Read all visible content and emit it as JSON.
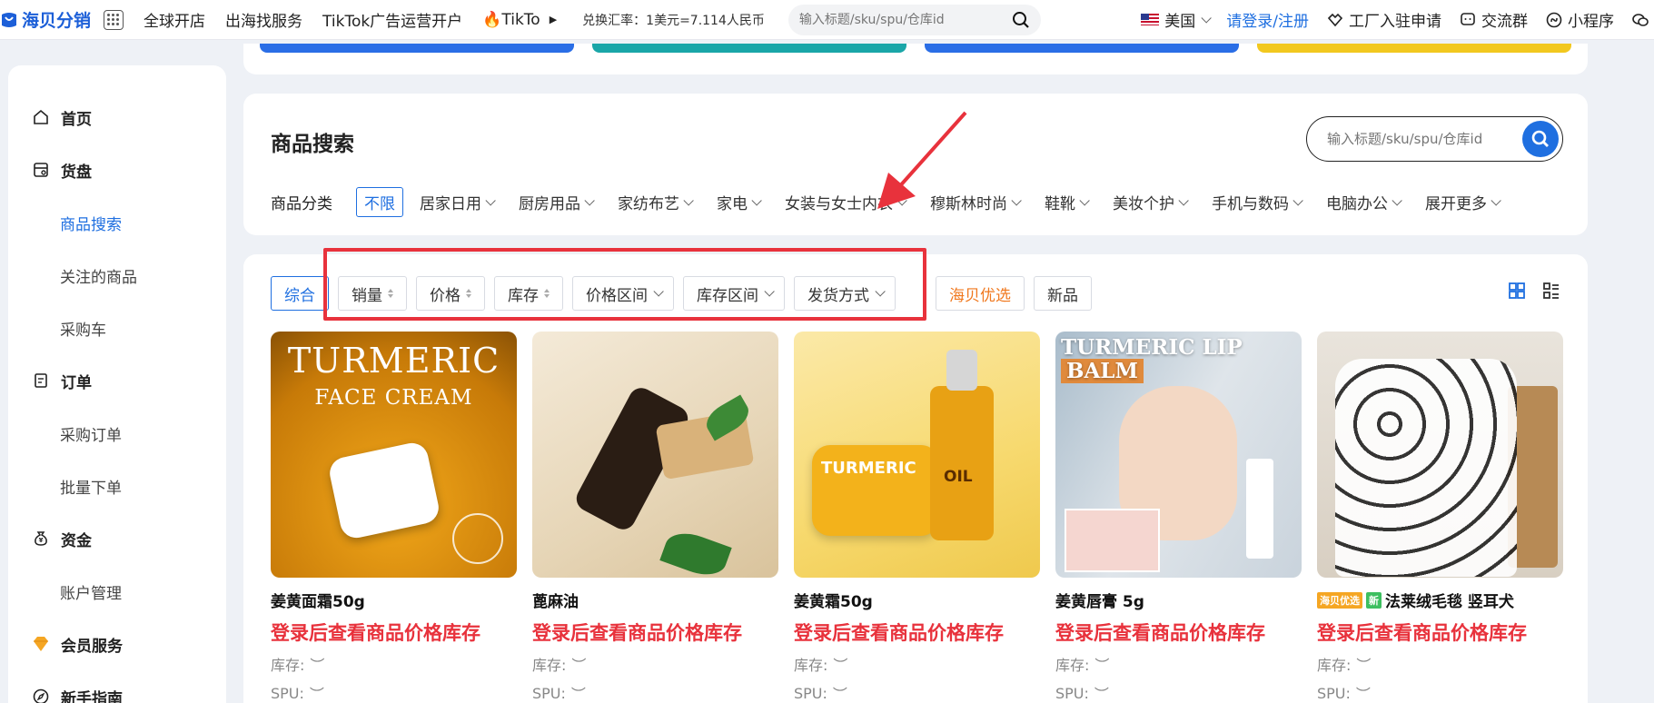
{
  "topbar": {
    "logo": "海贝分销",
    "nav": [
      "全球开店",
      "出海找服务",
      "TikTok广告运营开户",
      "🔥TikTo"
    ],
    "rate": "兑换汇率：1美元=7.114人民币",
    "search_placeholder": "输入标题/sku/spu/仓库id",
    "region": "美国",
    "login": "请登录/注册",
    "factory": "工厂入驻申请",
    "group": "交流群",
    "miniapp": "小程序"
  },
  "sidebar": {
    "items": [
      {
        "label": "首页",
        "type": "group"
      },
      {
        "label": "货盘",
        "type": "group"
      },
      {
        "label": "商品搜索",
        "type": "sub"
      },
      {
        "label": "关注的商品",
        "type": "sub"
      },
      {
        "label": "采购车",
        "type": "sub"
      },
      {
        "label": "订单",
        "type": "group"
      },
      {
        "label": "采购订单",
        "type": "sub"
      },
      {
        "label": "批量下单",
        "type": "sub"
      },
      {
        "label": "资金",
        "type": "group"
      },
      {
        "label": "账户管理",
        "type": "sub"
      },
      {
        "label": "会员服务",
        "type": "group"
      },
      {
        "label": "新手指南",
        "type": "group"
      }
    ]
  },
  "search_panel": {
    "title": "商品搜索",
    "search_placeholder": "输入标题/sku/spu/仓库id",
    "category_label": "商品分类",
    "category_all": "不限",
    "categories": [
      "居家日用",
      "厨房用品",
      "家纺布艺",
      "家电",
      "女装与女士内衣",
      "穆斯林时尚",
      "鞋靴",
      "美妆个护",
      "手机与数码",
      "电脑办公",
      "展开更多"
    ]
  },
  "filters": {
    "comprehensive": "综合",
    "sales": "销量",
    "price": "价格",
    "stock": "库存",
    "price_range": "价格区间",
    "stock_range": "库存区间",
    "shipping": "发货方式",
    "haibei_select": "海贝优选",
    "new": "新品"
  },
  "colors": {
    "primary": "#1f6fe0",
    "alert": "#e8323c",
    "orange": "#f0781e"
  },
  "products": [
    {
      "name": "姜黄面霜50g",
      "price_text": "登录后查看商品价格库存",
      "stock_label": "库存:",
      "spu_label": "SPU:",
      "image_text": [
        "TURMERIC",
        "FACE CREAM"
      ],
      "tags": []
    },
    {
      "name": "蓖麻油",
      "price_text": "登录后查看商品价格库存",
      "stock_label": "库存:",
      "spu_label": "SPU:",
      "image_text": [],
      "tags": []
    },
    {
      "name": "姜黄霜50g",
      "price_text": "登录后查看商品价格库存",
      "stock_label": "库存:",
      "spu_label": "SPU:",
      "image_text": [
        "TURMERIC",
        "OIL"
      ],
      "tags": []
    },
    {
      "name": "姜黄唇膏 5g",
      "price_text": "登录后查看商品价格库存",
      "stock_label": "库存:",
      "spu_label": "SPU:",
      "image_text": [
        "TURMERIC LIP",
        "BALM"
      ],
      "tags": []
    },
    {
      "name": "法莱绒毛毯 竖耳犬",
      "price_text": "登录后查看商品价格库存",
      "stock_label": "库存:",
      "spu_label": "SPU:",
      "image_text": [],
      "tags": [
        "海贝优选",
        "新"
      ]
    }
  ]
}
